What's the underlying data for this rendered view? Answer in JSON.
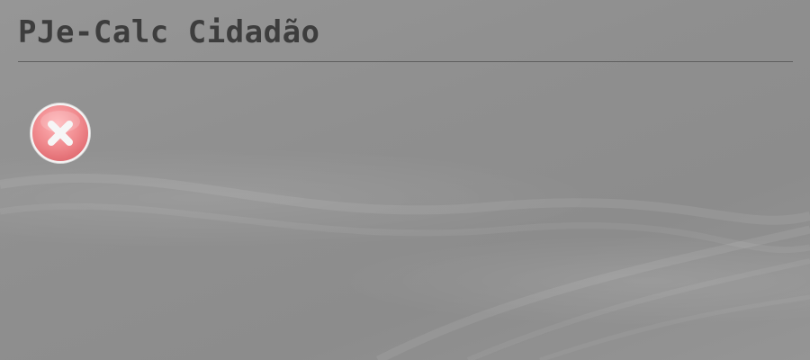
{
  "app": {
    "title": "PJe-Calc Cidadão"
  },
  "status": {
    "icon": "error-close-icon",
    "icon_fill": "#f08a8e",
    "icon_ring": "#e8e8e8"
  },
  "colors": {
    "background": "#8f8f8f",
    "title_text": "#3d3d3d",
    "divider": "#5f5f5f"
  }
}
